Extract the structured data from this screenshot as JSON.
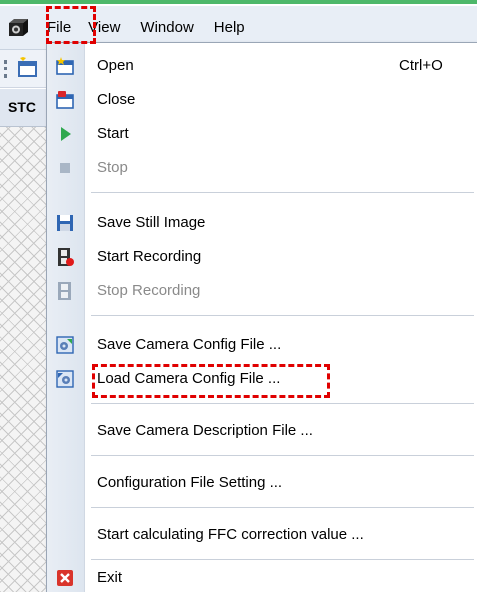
{
  "menubar": {
    "menus": [
      "File",
      "View",
      "Window",
      "Help"
    ]
  },
  "sidebar": {
    "tab_label": "STC"
  },
  "file_menu": {
    "items": [
      {
        "label": "Open",
        "shortcut": "Ctrl+O",
        "enabled": true,
        "icon": "open-icon"
      },
      {
        "label": "Close",
        "shortcut": "",
        "enabled": true,
        "icon": "close-doc-icon"
      },
      {
        "label": "Start",
        "shortcut": "",
        "enabled": true,
        "icon": "play-icon"
      },
      {
        "label": "Stop",
        "shortcut": "",
        "enabled": false,
        "icon": "stop-icon"
      },
      {
        "label": "Save Still Image",
        "shortcut": "",
        "enabled": true,
        "icon": "floppy-icon"
      },
      {
        "label": "Start Recording",
        "shortcut": "",
        "enabled": true,
        "icon": "film-record-icon"
      },
      {
        "label": "Stop Recording",
        "shortcut": "",
        "enabled": false,
        "icon": "film-icon"
      },
      {
        "label": "Save Camera Config File ...",
        "shortcut": "",
        "enabled": true,
        "icon": "config-save-icon"
      },
      {
        "label": "Load Camera Config File ...",
        "shortcut": "",
        "enabled": true,
        "icon": "config-load-icon"
      },
      {
        "label": "Save Camera Description File ...",
        "shortcut": "",
        "enabled": true,
        "icon": ""
      },
      {
        "label": "Configuration File Setting ...",
        "shortcut": "",
        "enabled": true,
        "icon": ""
      },
      {
        "label": "Start calculating FFC correction value ...",
        "shortcut": "",
        "enabled": true,
        "icon": ""
      },
      {
        "label": "Exit",
        "shortcut": "",
        "enabled": true,
        "icon": "exit-icon"
      }
    ]
  },
  "colors": {
    "highlight_box": "#e00000",
    "menubar_bg": "#e8eef6",
    "disabled_text": "#8a8a8a"
  }
}
